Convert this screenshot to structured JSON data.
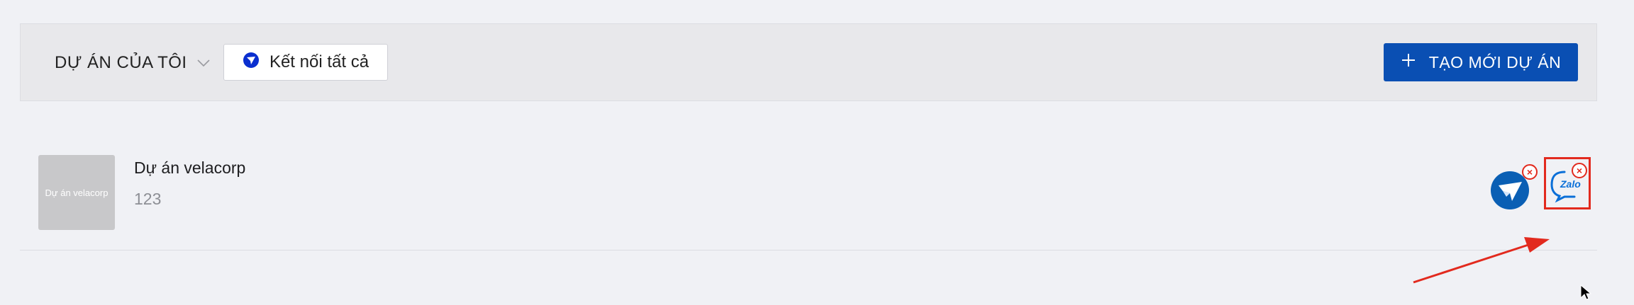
{
  "toolbar": {
    "project_dropdown_label": "DỰ ÁN CỦA TÔI",
    "connect_all_label": "Kết nối tất cả",
    "create_label": "TẠO MỚI DỰ ÁN"
  },
  "projects": [
    {
      "thumbnail_text": "Dự án velacorp",
      "name": "Dự án velacorp",
      "description": "123",
      "channels": [
        {
          "icon": "messenger-channel-icon",
          "remove_symbol": "×"
        },
        {
          "icon": "zalo-channel-icon",
          "label": "Zalo",
          "remove_symbol": "×",
          "highlighted": true
        }
      ]
    }
  ],
  "colors": {
    "primary": "#0a4fb3",
    "messenger_blue": "#0a5fb4",
    "highlight_red": "#e22a1e",
    "background": "#f0f1f5",
    "toolbar_bg": "#e8e8eb"
  }
}
